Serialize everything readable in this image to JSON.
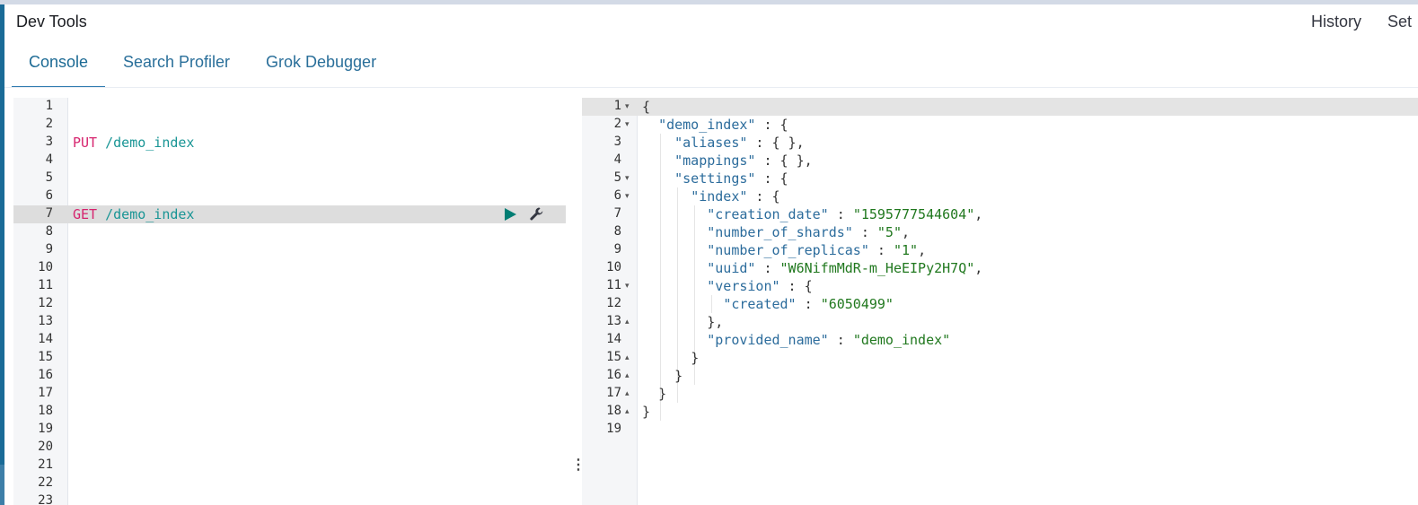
{
  "header": {
    "title": "Dev Tools",
    "history": "History",
    "settings": "Set"
  },
  "tabs": [
    {
      "label": "Console",
      "active": true
    },
    {
      "label": "Search Profiler",
      "active": false
    },
    {
      "label": "Grok Debugger",
      "active": false
    }
  ],
  "request_editor": {
    "line_numbers": [
      "1",
      "2",
      "3",
      "4",
      "5",
      "6",
      "7",
      "8",
      "9",
      "10",
      "11",
      "12",
      "13",
      "14",
      "15",
      "16",
      "17",
      "18",
      "19",
      "20",
      "21",
      "22",
      "23"
    ],
    "requests": [
      {
        "method": "PUT",
        "path": "/demo_index"
      },
      {
        "method": "GET",
        "path": "/demo_index"
      }
    ],
    "active_line": "7",
    "actions": {
      "run_icon": "play-icon",
      "settings_icon": "wrench-icon"
    }
  },
  "response_editor": {
    "line_numbers": [
      "1",
      "2",
      "3",
      "4",
      "5",
      "6",
      "7",
      "8",
      "9",
      "10",
      "11",
      "12",
      "13",
      "14",
      "15",
      "16",
      "17",
      "18",
      "19"
    ],
    "json": {
      "open_root": "{",
      "index_key": "\"demo_index\"",
      "aliases_key": "\"aliases\"",
      "aliases_val": "{ },",
      "mappings_key": "\"mappings\"",
      "mappings_val": "{ },",
      "settings_key": "\"settings\"",
      "index_settings_key": "\"index\"",
      "creation_date_key": "\"creation_date\"",
      "creation_date_val": "\"1595777544604\"",
      "shards_key": "\"number_of_shards\"",
      "shards_val": "\"5\"",
      "replicas_key": "\"number_of_replicas\"",
      "replicas_val": "\"1\"",
      "uuid_key": "\"uuid\"",
      "uuid_val": "\"W6NifmMdR-m_HeEIPy2H7Q\"",
      "version_key": "\"version\"",
      "created_key": "\"created\"",
      "created_val": "\"6050499\"",
      "close_version": "},",
      "provided_name_key": "\"provided_name\"",
      "provided_name_val": "\"demo_index\"",
      "close": "}"
    }
  },
  "resizer": {
    "icon": "vertical-dots-icon"
  }
}
